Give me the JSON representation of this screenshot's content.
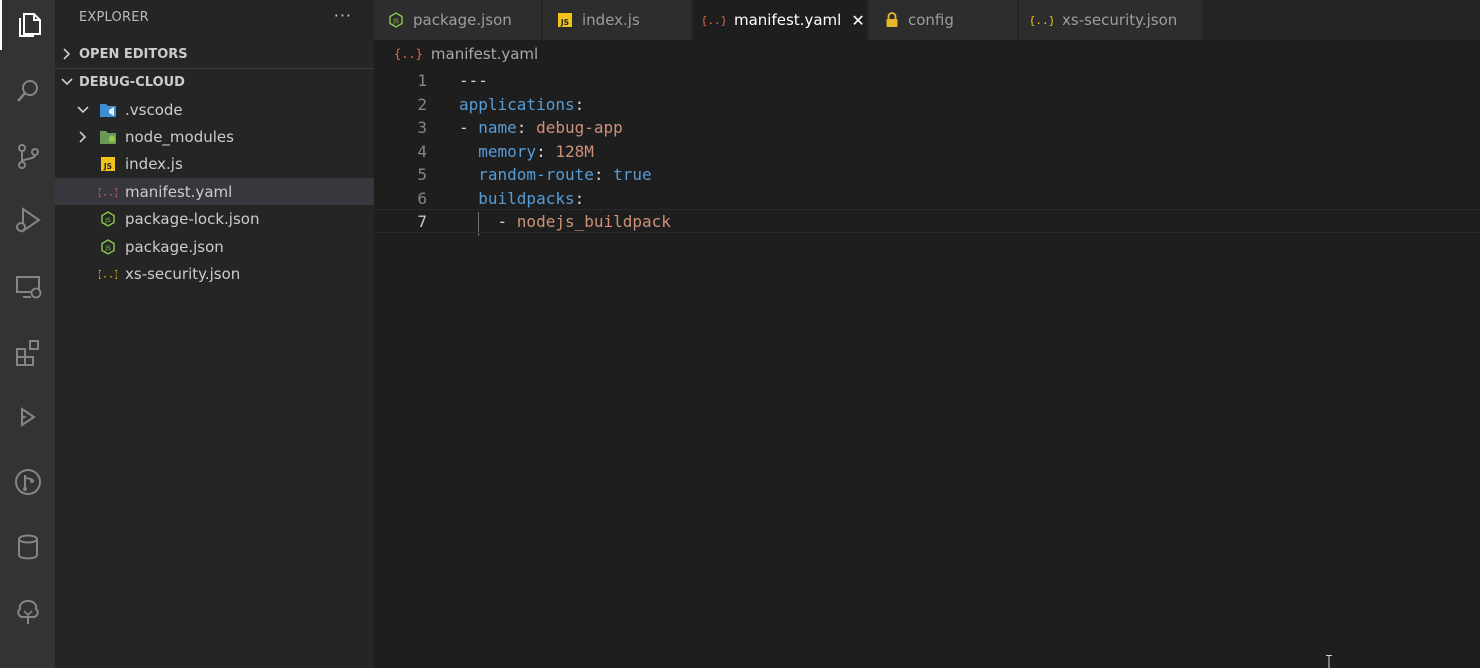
{
  "activity_bar": {
    "items": [
      {
        "icon": "files-icon",
        "active": true
      },
      {
        "icon": "search-icon"
      },
      {
        "icon": "source-control-icon"
      },
      {
        "icon": "run-debug-icon"
      },
      {
        "icon": "remote-explorer-icon"
      },
      {
        "icon": "extensions-icon"
      },
      {
        "icon": "deploy-icon"
      },
      {
        "icon": "git-graph-icon"
      },
      {
        "icon": "database-icon"
      },
      {
        "icon": "tree-icon"
      }
    ]
  },
  "sidebar": {
    "title": "EXPLORER",
    "more": "···",
    "open_editors_label": "OPEN EDITORS",
    "folder_label": "DEBUG-CLOUD",
    "tree": [
      {
        "label": ".vscode",
        "icon": "folder-vscode-icon",
        "expanded": true
      },
      {
        "label": "node_modules",
        "icon": "folder-node-icon",
        "expanded": false
      },
      {
        "label": "index.js",
        "icon": "js-icon"
      },
      {
        "label": "manifest.yaml",
        "icon": "yaml-icon",
        "selected": true
      },
      {
        "label": "package-lock.json",
        "icon": "nodejs-icon"
      },
      {
        "label": "package.json",
        "icon": "nodejs-icon"
      },
      {
        "label": "xs-security.json",
        "icon": "json-icon"
      }
    ]
  },
  "tabs": [
    {
      "label": "package.json",
      "icon": "nodejs-icon"
    },
    {
      "label": "index.js",
      "icon": "js-icon"
    },
    {
      "label": "manifest.yaml",
      "icon": "yaml-icon",
      "active": true,
      "close": "✕"
    },
    {
      "label": "config",
      "icon": "lock-icon"
    },
    {
      "label": "xs-security.json",
      "icon": "json-icon"
    }
  ],
  "breadcrumb": {
    "icon_text": "{..}",
    "file": "manifest.yaml"
  },
  "editor": {
    "line_numbers": [
      "1",
      "2",
      "3",
      "4",
      "5",
      "6",
      "7"
    ],
    "lines": [
      {
        "parts": [
          {
            "t": "---",
            "c": "punc"
          }
        ]
      },
      {
        "parts": [
          {
            "t": "applications",
            "c": "key"
          },
          {
            "t": ":",
            "c": "punc"
          }
        ]
      },
      {
        "parts": [
          {
            "t": "- ",
            "c": "punc"
          },
          {
            "t": "name",
            "c": "key"
          },
          {
            "t": ": ",
            "c": "punc"
          },
          {
            "t": "debug-app",
            "c": "str"
          }
        ]
      },
      {
        "parts": [
          {
            "t": "  ",
            "c": "punc"
          },
          {
            "t": "memory",
            "c": "key"
          },
          {
            "t": ": ",
            "c": "punc"
          },
          {
            "t": "128M",
            "c": "str"
          }
        ]
      },
      {
        "parts": [
          {
            "t": "  ",
            "c": "punc"
          },
          {
            "t": "random-route",
            "c": "key"
          },
          {
            "t": ": ",
            "c": "punc"
          },
          {
            "t": "true",
            "c": "bool"
          }
        ]
      },
      {
        "parts": [
          {
            "t": "  ",
            "c": "punc"
          },
          {
            "t": "buildpacks",
            "c": "key"
          },
          {
            "t": ":",
            "c": "punc"
          }
        ]
      },
      {
        "parts": [
          {
            "t": "    - ",
            "c": "punc"
          },
          {
            "t": "nodejs_buildpack",
            "c": "str"
          }
        ]
      }
    ]
  },
  "colors": {
    "yaml_icon": "#e06c4b",
    "js_icon": "#f0c419",
    "node_icon": "#8cc84b",
    "json_icon": "#f0c419",
    "lock_icon": "#e8b72c"
  }
}
